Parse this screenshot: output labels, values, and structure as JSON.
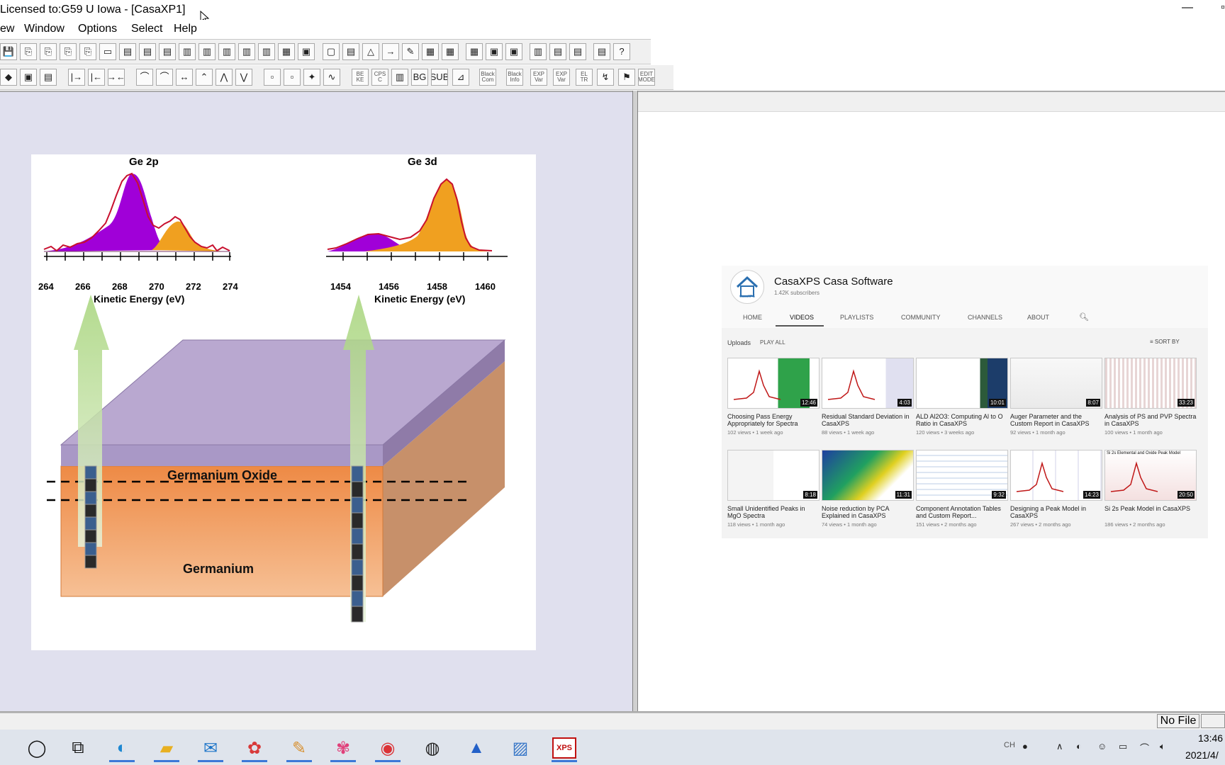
{
  "window": {
    "title": "Licensed to:G59 U Iowa - [CasaXP1]",
    "controls": {
      "minimize": "—",
      "maximize": "▫"
    }
  },
  "menu": {
    "items": [
      "ew",
      "Window",
      "Options",
      "Select",
      "Help"
    ]
  },
  "toolbar2": {
    "labels": [
      "BE\nKE",
      "CPS\nC",
      "Black\nCom",
      "Black\nInfo",
      "EXP\nVar",
      "EXP\nVar",
      "EL\nTR",
      "EDIT\nMODE"
    ]
  },
  "figure": {
    "plots": [
      {
        "title": "Ge 2p",
        "xlabel": "Kinetic Energy (eV)",
        "ticks": [
          "264",
          "266",
          "268",
          "270",
          "272",
          "274"
        ],
        "colors": {
          "peak1": "#a000d8",
          "peak2": "#f0a020",
          "envelope": "#c8102e"
        }
      },
      {
        "title": "Ge 3d",
        "xlabel": "Kinetic Energy (eV)",
        "ticks": [
          "1454",
          "1456",
          "1458",
          "1460"
        ],
        "colors": {
          "peak1": "#a000d8",
          "peak2": "#f0a020",
          "envelope": "#c8102e"
        }
      }
    ],
    "layers": {
      "top": "Germanium Oxide",
      "bottom": "Germanium"
    },
    "colors": {
      "oxide_top": "#b9a8d0",
      "oxide_side": "#8f7ba8",
      "bulk_front": "#f0a060",
      "bulk_side": "#c8906a",
      "arrow": "#9ed06a"
    }
  },
  "youtube": {
    "channel": "CasaXPS Casa Software",
    "subscribers": "1.42K subscribers",
    "logo_text": "CasaXPS",
    "tabs": [
      "HOME",
      "VIDEOS",
      "PLAYLISTS",
      "COMMUNITY",
      "CHANNELS",
      "ABOUT"
    ],
    "uploads": "Uploads",
    "play_all": "PLAY ALL",
    "sort_by": "SORT BY",
    "videos": [
      {
        "title": "Choosing Pass Energy Appropriately for Spectra",
        "meta": "102 views • 1 week ago",
        "duration": "12:46",
        "thumb": "spectrum-green"
      },
      {
        "title": "Residual Standard Deviation in CasaXPS",
        "meta": "88 views • 1 week ago",
        "duration": "4:03",
        "thumb": "spectrum-red"
      },
      {
        "title": "ALD Al2O3: Computing Al to O Ratio in CasaXPS",
        "meta": "120 views • 3 weeks ago",
        "duration": "10:01",
        "thumb": "table-dark"
      },
      {
        "title": "Auger Parameter and the Custom Report in CasaXPS",
        "meta": "92 views • 1 month ago",
        "duration": "8:07",
        "thumb": "white-plot"
      },
      {
        "title": "Analysis of PS and PVP Spectra in CasaXPS",
        "meta": "100 views • 1 month ago",
        "duration": "33:23",
        "thumb": "many-lines"
      },
      {
        "title": "Small Unidentified Peaks in MgO Spectra",
        "meta": "118 views • 1 month ago",
        "duration": "8:18",
        "thumb": "mgo"
      },
      {
        "title": "Noise reduction by PCA Explained in CasaXPS",
        "meta": "74 views • 1 month ago",
        "duration": "11:31",
        "thumb": "pca"
      },
      {
        "title": "Component Annotation Tables and Custom Report...",
        "meta": "151 views • 2 months ago",
        "duration": "9:32",
        "thumb": "tables"
      },
      {
        "title": "Designing a Peak Model in CasaXPS",
        "meta": "267 views • 2 months ago",
        "duration": "14:23",
        "thumb": "peak-model"
      },
      {
        "title": "Si 2s Peak Model in CasaXPS",
        "meta": "186 views • 2 months ago",
        "duration": "20:50",
        "thumb": "si2s",
        "overlay": "Si 2s Elemental and Oxide Peak Model"
      }
    ]
  },
  "statusbar": {
    "file": "No File"
  },
  "taskbar": {
    "apps": [
      "search-circle",
      "task-view",
      "edge",
      "file-explorer",
      "mail",
      "app-red",
      "paint",
      "app-pink",
      "chrome",
      "obs",
      "app-blue",
      "photos",
      "casaxps"
    ],
    "casaxps_label": "XPS",
    "tray": {
      "ime": "CH",
      "time": "13:46",
      "date": "2021/4/"
    }
  }
}
